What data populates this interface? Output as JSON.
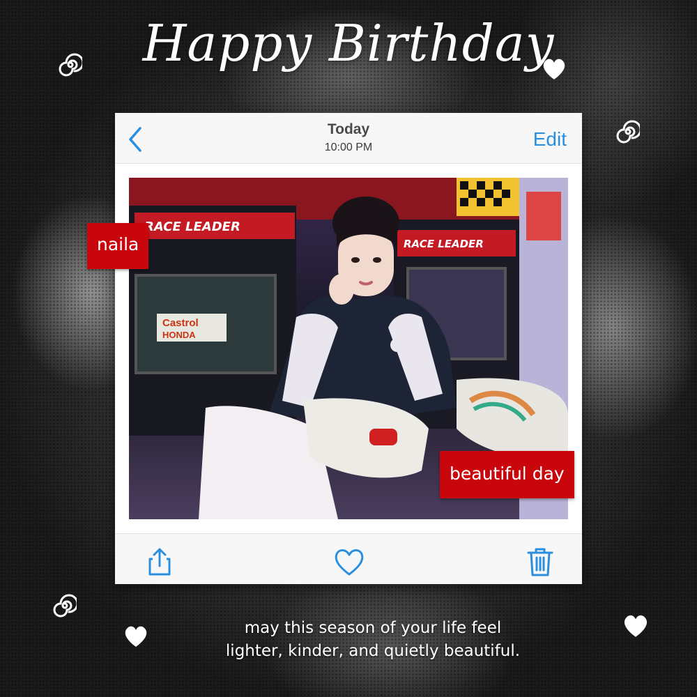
{
  "title": "Happy Birthday",
  "photo_viewer": {
    "nav": {
      "title": "Today",
      "subtitle": "10:00 PM",
      "edit_label": "Edit",
      "back_icon": "chevron-left-icon"
    },
    "photo": {
      "signs": {
        "race_leader_left": "RACE LEADER",
        "race_leader_right": "RACE LEADER",
        "castrol": "Castrol",
        "honda": "HONDA"
      }
    },
    "toolbar": {
      "share_icon": "share-icon",
      "like_icon": "heart-icon",
      "delete_icon": "trash-icon"
    }
  },
  "tags": {
    "name": "naila",
    "caption": "beautiful day"
  },
  "message": {
    "line1": "may this season of your life feel",
    "line2": "lighter, kinder, and quietly beautiful."
  },
  "colors": {
    "accent_blue": "#2b8fe0",
    "tag_red": "#c8060c"
  }
}
